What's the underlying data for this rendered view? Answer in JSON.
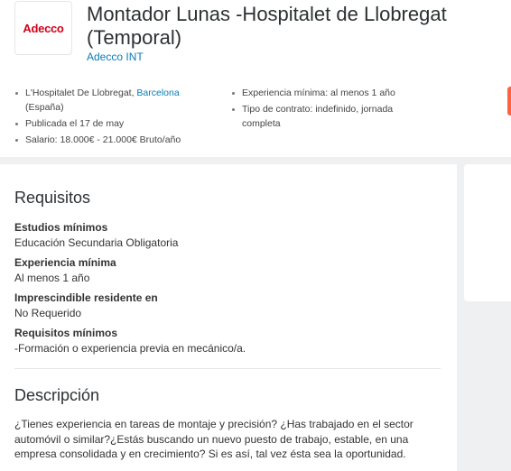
{
  "header": {
    "logo_text": "Adecco",
    "title": "Montador Lunas -Hospitalet de Llobregat (Temporal)",
    "company": "Adecco INT"
  },
  "facts_left": {
    "location_prefix": "L'Hospitalet De Llobregat, ",
    "location_link": "Barcelona",
    "location_suffix": " (España)",
    "published": "Publicada el 17 de may",
    "salary": "Salario: 18.000€ - 21.000€ Bruto/año"
  },
  "facts_right": {
    "experience": "Experiencia mínima: al menos 1 año",
    "contract": "Tipo de contrato: indefinido, jornada completa"
  },
  "requirements": {
    "title": "Requisitos",
    "items": [
      {
        "label": "Estudios mínimos",
        "value": "Educación Secundaria Obligatoria"
      },
      {
        "label": "Experiencia mínima",
        "value": "Al menos 1 año"
      },
      {
        "label": "Imprescindible residente en",
        "value": "No Requerido"
      },
      {
        "label": "Requisitos mínimos",
        "value": "-Formación o experiencia previa en mecánico/a."
      }
    ]
  },
  "description": {
    "title": "Descripción",
    "text": "¿Tienes experiencia en tareas de montaje y precisión? ¿Has trabajado en el sector automóvil o similar?¿Estás buscando un nuevo puesto de trabajo, estable, en una empresa consolidada y en crecimiento? Si es así, tal vez ésta sea la oportunidad."
  },
  "colors": {
    "brand": "#d0021b",
    "link": "#0a7cb5",
    "apply": "#ff6340"
  }
}
